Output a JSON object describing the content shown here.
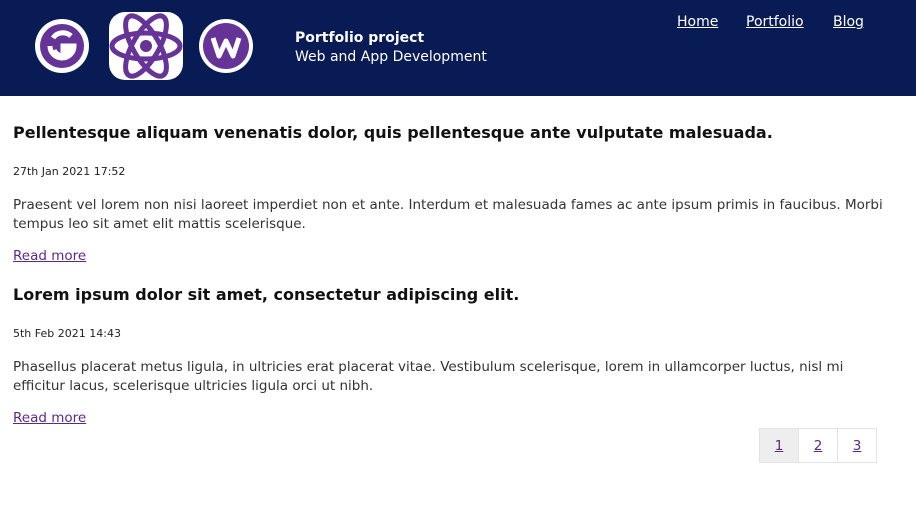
{
  "header": {
    "title": "Portfolio project",
    "subtitle": "Web and App Development",
    "bg_color": "#081b55",
    "logos": [
      "gatsby-logo",
      "react-logo",
      "wordpress-logo"
    ],
    "logo_color": "#663399",
    "nav": {
      "home": "Home",
      "portfolio": "Portfolio",
      "blog": "Blog"
    }
  },
  "posts": [
    {
      "title": "Pellentesque aliquam venenatis dolor, quis pellentesque ante vulputate malesuada.",
      "date": "27th Jan 2021 17:52",
      "excerpt": "Praesent vel lorem non nisi laoreet imperdiet non et ante. Interdum et malesuada fames ac ante ipsum primis in faucibus. Morbi tempus leo sit amet elit mattis scelerisque.",
      "read_more": "Read more"
    },
    {
      "title": "Lorem ipsum dolor sit amet, consectetur adipiscing elit.",
      "date": "5th Feb 2021 14:43",
      "excerpt": "Phasellus placerat metus ligula, in ultricies erat placerat vitae. Vestibulum scelerisque, lorem in ullamcorper luctus, nisl mi efficitur lacus, scelerisque ultricies ligula orci ut nibh.",
      "read_more": "Read more"
    }
  ],
  "pagination": {
    "pages": [
      "1",
      "2",
      "3"
    ],
    "current": "1"
  },
  "colors": {
    "link": "#5b2a86",
    "active_page_bg": "#eeeeee"
  }
}
